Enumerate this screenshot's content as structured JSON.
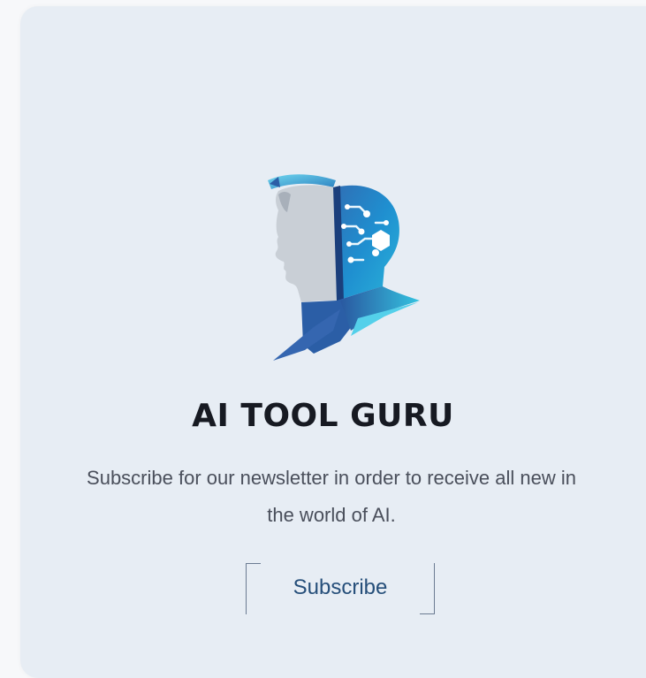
{
  "brand": {
    "name": "AI TOOL GURU",
    "logo_icon": "ai-head-circuit-icon",
    "colors": {
      "accent_blue": "#1a89c4",
      "cyan": "#3dc9e8",
      "navy": "#2d4d8c",
      "face_gray": "#c9cfd6"
    }
  },
  "newsletter": {
    "description": "Subscribe for our newsletter in order to receive all new in the world of AI.",
    "subscribe_label": "Subscribe"
  }
}
